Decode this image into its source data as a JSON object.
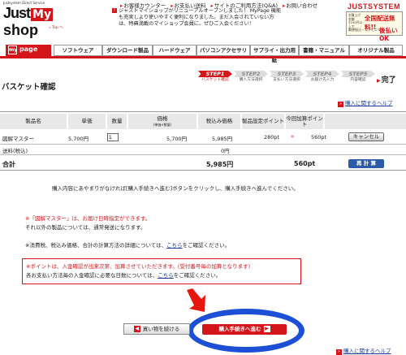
{
  "header": {
    "logo_caption": "Justsystem Direct Service",
    "logo_part1": "Just",
    "logo_mark": "My",
    "logo_part2": "shop",
    "top_link": "« Top へ",
    "links": [
      "お客様カウンター",
      "お支払い送料",
      "サイトのご利用方法(Q&A)",
      "お問い合わせ"
    ],
    "announcement": "ジャストマイショップがリニューアルオープンしました！ MyPage 機能も充実しより使いやすく便利になりました。まだ入会されていない方は、特典満載のマイショップ会員に、ぜひご入会ください！",
    "brand": "JUSTSYSTEM",
    "free_ship_small": "お買上げ金額 3150円以上で",
    "free_ship_big": "全国配送無料!!",
    "pay_small": "郵便振込・コンビニで",
    "pay_big": "後払いOK"
  },
  "nav": {
    "mypage_icon": "my",
    "mypage_label": "page",
    "tabs": [
      "ソフトウェア",
      "ダウンロード製品",
      "ハードウェア",
      "パソコンアクセサリ",
      "サプライ・出力用紙",
      "書籍・マニュアル",
      "オリジナル製品"
    ]
  },
  "page": {
    "title": "バスケット確認",
    "help_link": "購入に関するヘルプ",
    "steps": [
      {
        "num": "STEP1",
        "label": "バスケット確認"
      },
      {
        "num": "STEP2",
        "label": "購入方法選択"
      },
      {
        "num": "STEP3",
        "label": "支払い方法選択"
      },
      {
        "num": "STEP4",
        "label": "お届け先入力"
      },
      {
        "num": "STEP5",
        "label": "内容確認"
      }
    ],
    "done_label": "完了"
  },
  "table": {
    "headers": {
      "product": "製品名",
      "unit": "単価",
      "qty": "数量",
      "price": "価格",
      "price_sub": "(単価×数量)",
      "tax": "税込み価格",
      "pt_set": "製品設定ポイント",
      "pt_add": "今回加算ポイント"
    },
    "row": {
      "product": "図解マスター",
      "unit": "5,700円",
      "qty": "1",
      "price": "5,700円",
      "tax": "5,985円",
      "pt_set": "280pt",
      "arrow": "»",
      "pt_add": "560pt",
      "cancel": "キャンセル"
    },
    "shipping_label": "送料(税込)",
    "shipping_value": "0円",
    "total_label": "合計",
    "total_price": "5,985円",
    "total_points": "560pt",
    "recalc": "再 計 算"
  },
  "messages": {
    "instruction": "購入内容にあやまりがなければ[購入手続きへ進む]ボタンをクリックし、購入手続きへ進んでください。",
    "note1": "※「図解マスター」は、お届け日時指定ができます。",
    "note2": "それ以外の製品については、通常発送になります。",
    "note3_pre": "※消費税、税込み価格、合計の計算方法の詳細については、",
    "note3_link": "こちら",
    "note3_post": "をご確認ください。",
    "box1": "※ポイントは、入金確認が出来次第、加算させていただきます。(受付番号毎の加算となります)",
    "box2_pre": "各お支払い方法毎の入金確認に必要な日数については、",
    "box2_link": "こちら",
    "box2_post": "をご確認ください。"
  },
  "buttons": {
    "back": "買い物を続ける",
    "proceed": "購入手続きへ進む"
  },
  "colors": {
    "accent": "#d4161a",
    "link": "#1a3d99",
    "highlight": "#1d4fd6",
    "recalc": "#2a5aa8"
  }
}
